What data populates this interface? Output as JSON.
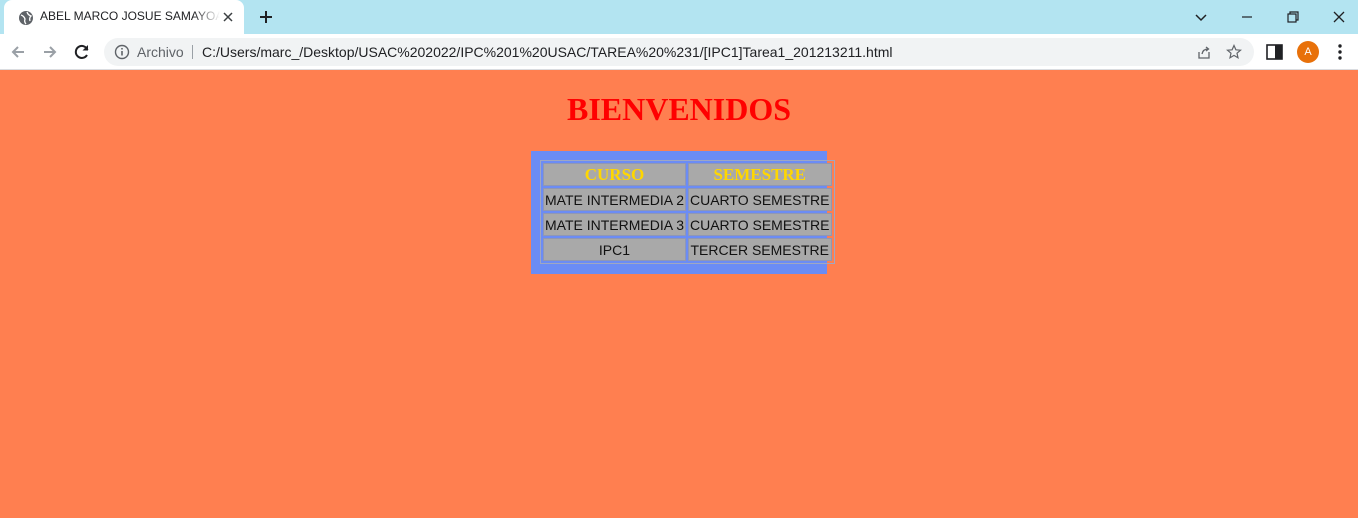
{
  "browser": {
    "tab": {
      "title": "ABEL MARCO JOSUE SAMAYOA P"
    },
    "new_tab": "+",
    "omnibox": {
      "site_label": "Archivo",
      "url": "C:/Users/marc_/Desktop/USAC%202022/IPC%201%20USAC/TAREA%20%231/[IPC1]Tarea1_201213211.html"
    },
    "profile_initial": "A"
  },
  "page": {
    "heading": "BIENVENIDOS",
    "table": {
      "headers": [
        "CURSO",
        "SEMESTRE"
      ],
      "rows": [
        [
          "MATE INTERMEDIA 2",
          "CUARTO SEMESTRE"
        ],
        [
          "MATE INTERMEDIA 3",
          "CUARTO SEMESTRE"
        ],
        [
          "IPC1",
          "TERCER SEMESTRE"
        ]
      ]
    }
  },
  "colors": {
    "page_background": "#ff7f50",
    "heading": "#ff0000",
    "table_background": "#6b8cf5",
    "cell_background": "#a9a9a9",
    "header_text": "#ffd700",
    "tab_strip": "#b3e4f1",
    "avatar": "#e8710a"
  }
}
